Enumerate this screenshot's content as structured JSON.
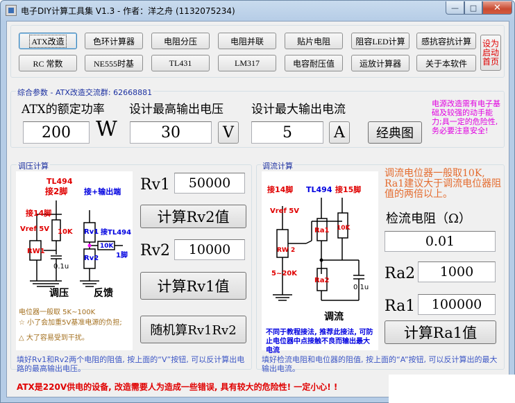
{
  "window": {
    "title": "电子DIY计算工具集 V1.3   - 作者：洋之舟 (1132075234)",
    "min_label": "—",
    "max_label": "□",
    "close_label": "✕"
  },
  "toolbar": {
    "row1": [
      "ATX改造",
      "色环计算器",
      "电阻分压",
      "电阻并联",
      "贴片电阻",
      "阻容LED计算",
      "感抗容抗计算"
    ],
    "row2": [
      "RC 常数",
      "NE555时基",
      "TL431",
      "LM317",
      "电容耐压值",
      "运放计算器",
      "关于本软件"
    ],
    "support_label": "设为启动首页"
  },
  "params": {
    "legend": "综合参数 - ATX改造交流群: 62668881",
    "power_label": "ATX的额定功率",
    "voltage_label": "设计最高输出电压",
    "current_label": "设计最大输出电流",
    "power_value": "200",
    "power_unit": "W",
    "voltage_value": "30",
    "voltage_unit": "V",
    "current_value": "5",
    "current_unit": "A",
    "classic_button": "经典图",
    "warning_note": "电源改造需有电子基础及较强的动手能力;具一定的危险性,务必要注意安全!"
  },
  "voltage_calc": {
    "legend": "调压计算",
    "rv1_label": "Rv1",
    "rv1_value": "50000",
    "calc_rv2_button": "计算Rv2值",
    "rv2_label": "Rv2",
    "rv2_value": "10000",
    "calc_rv1_button": "计算Rv1值",
    "random_button": "随机算Rv1Rv2",
    "hint": "填好Rv1和Rv2两个电阻的阻值, 按上面的“V”按钮, 可以反计算出电路的最高输出电压。",
    "schematic": {
      "tl494_pin2": "TL494",
      "pin2": "接2脚",
      "plus_out": "接+输出端",
      "pin14": "接14脚",
      "vref": "Vref 5V",
      "r10k": "10K",
      "rw1": "RW1",
      "c01": "0.1u",
      "rv1": "Rv1",
      "rv2": "Rv2",
      "tl494b": "接TL494",
      "pin1": "1脚",
      "r10k2": "10K",
      "regulate": "调压",
      "feedback": "反馈",
      "note1": "电位器一般取 5K~100K",
      "note2": "☆ 小了会加重5V基准电源的负担;",
      "note3": "△ 大了容易受到干扰。"
    }
  },
  "current_calc": {
    "legend": "调流计算",
    "desc": "调流电位器一般取10K, Ra1建议大于调流电位器阻值的两倍以上。",
    "sense_label": "检流电阻（Ω）",
    "sense_value": "0.01",
    "ra2_label": "Ra2",
    "ra2_value": "1000",
    "ra1_label": "Ra1",
    "ra1_value": "100000",
    "calc_ra1_button": "计算Ra1值",
    "hint": "填好检流电阻和电位器的阻值, 按上面的“A”按钮, 可以反计算出的最大输出电流。",
    "schematic": {
      "pin14": "接14脚",
      "tl494": "TL494",
      "pin15": "接15脚",
      "vref": "Vref 5V",
      "ra1": "Ra1",
      "r10k": "10K",
      "rw2": "RW 2",
      "ra2": "Ra2",
      "range": "5~20K",
      "c01": "0.1u",
      "regulate": "调流",
      "note": "不同于教程接法, 推荐此接法, 可防止电位器中点接触不良而输出最大电流"
    }
  },
  "bottom_warning": "ATX是220V供电的设备, 改造需要人为造成一些错误, 具有较大的危险性! 一定小心! !",
  "colors": {
    "legend": "#1a2fa0",
    "warning_red": "#e00000",
    "magenta": "#e000e0",
    "hint_blue": "#3d57c5",
    "schematic_red": "#e00000",
    "schematic_blue": "#0000e0"
  }
}
